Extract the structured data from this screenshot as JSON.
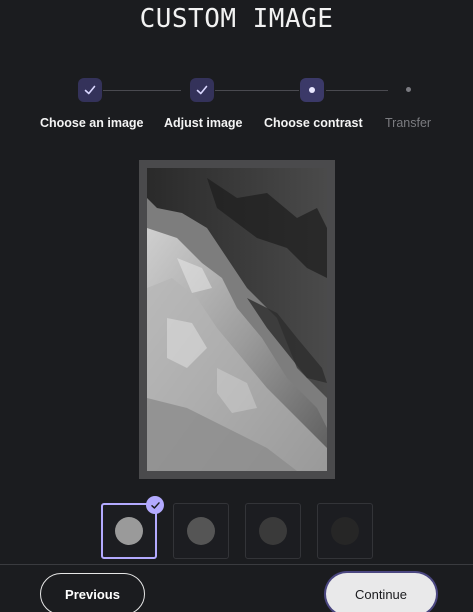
{
  "title": "CUSTOM IMAGE",
  "steps": [
    {
      "label": "Choose an image",
      "state": "done",
      "icon": "check-icon"
    },
    {
      "label": "Adjust image",
      "state": "done",
      "icon": "check-icon"
    },
    {
      "label": "Choose contrast",
      "state": "current",
      "icon": "dot-icon"
    },
    {
      "label": "Transfer",
      "state": "pending",
      "icon": "dot-icon"
    }
  ],
  "contrast_options": [
    {
      "shade": "#9a9a9a",
      "selected": true
    },
    {
      "shade": "#555555",
      "selected": false
    },
    {
      "shade": "#3a3a3a",
      "selected": false
    },
    {
      "shade": "#262626",
      "selected": false
    }
  ],
  "buttons": {
    "previous": "Previous",
    "continue": "Continue"
  },
  "colors": {
    "background": "#1b1c1f",
    "accent": "#b3aaff",
    "step_node": "#34325a"
  }
}
